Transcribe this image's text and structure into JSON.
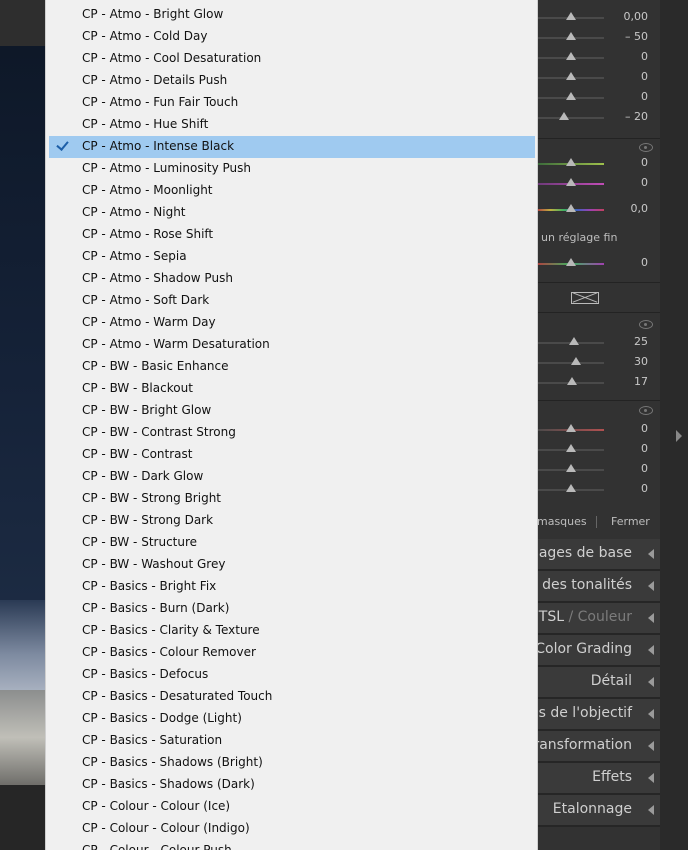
{
  "menu": {
    "items": [
      {
        "label": "CP - Atmo - Bright Glow"
      },
      {
        "label": "CP - Atmo - Cold Day"
      },
      {
        "label": "CP - Atmo - Cool Desaturation"
      },
      {
        "label": "CP - Atmo - Details Push"
      },
      {
        "label": "CP - Atmo - Fun Fair Touch"
      },
      {
        "label": "CP - Atmo - Hue Shift"
      },
      {
        "label": "CP - Atmo - Intense Black",
        "selected": true
      },
      {
        "label": "CP - Atmo - Luminosity Push"
      },
      {
        "label": "CP - Atmo - Moonlight"
      },
      {
        "label": "CP - Atmo - Night"
      },
      {
        "label": "CP - Atmo - Rose Shift"
      },
      {
        "label": "CP - Atmo - Sepia"
      },
      {
        "label": "CP - Atmo - Shadow Push"
      },
      {
        "label": "CP - Atmo - Soft Dark"
      },
      {
        "label": "CP - Atmo - Warm Day"
      },
      {
        "label": "CP - Atmo - Warm Desaturation"
      },
      {
        "label": "CP - BW - Basic Enhance"
      },
      {
        "label": "CP - BW - Blackout"
      },
      {
        "label": "CP - BW - Bright Glow"
      },
      {
        "label": "CP - BW - Contrast Strong"
      },
      {
        "label": "CP - BW - Contrast"
      },
      {
        "label": "CP - BW - Dark Glow"
      },
      {
        "label": "CP - BW - Strong Bright"
      },
      {
        "label": "CP - BW - Strong Dark"
      },
      {
        "label": "CP - BW - Structure"
      },
      {
        "label": "CP - BW - Washout Grey"
      },
      {
        "label": "CP - Basics - Bright Fix"
      },
      {
        "label": "CP - Basics - Burn (Dark)"
      },
      {
        "label": "CP - Basics - Clarity & Texture"
      },
      {
        "label": "CP - Basics - Colour Remover"
      },
      {
        "label": "CP - Basics - Defocus"
      },
      {
        "label": "CP - Basics - Desaturated Touch"
      },
      {
        "label": "CP - Basics - Dodge (Light)"
      },
      {
        "label": "CP - Basics - Saturation"
      },
      {
        "label": "CP - Basics - Shadows (Bright)"
      },
      {
        "label": "CP - Basics - Shadows (Dark)"
      },
      {
        "label": "CP - Colour - Colour (Ice)"
      },
      {
        "label": "CP - Colour - Colour (Indigo)"
      },
      {
        "label": "CP - Colour - Colour Push"
      }
    ],
    "selected_color": "#9fcaf0"
  },
  "panel": {
    "sliders_top": [
      {
        "value": "0,00",
        "level": 0.5
      },
      {
        "value": "– 50",
        "level": 0.5
      },
      {
        "value": "0",
        "level": 0.5
      },
      {
        "value": "0",
        "level": 0.5
      },
      {
        "value": "0",
        "level": 0.5
      },
      {
        "value": "– 20",
        "level": 0.4
      }
    ],
    "sliders_color": [
      {
        "value": "0",
        "level": 0.5
      },
      {
        "value": "0",
        "level": 0.5
      },
      {
        "value": "0,0",
        "level": 0.5
      }
    ],
    "fine_adjust_text": "un réglage fin",
    "slider_fine": {
      "value": "0",
      "level": 0.5
    },
    "sliders_mid": [
      {
        "value": "25",
        "level": 0.55
      },
      {
        "value": "30",
        "level": 0.58
      },
      {
        "value": "17",
        "level": 0.52
      }
    ],
    "sliders_bottom": [
      {
        "value": "0",
        "level": 0.5
      },
      {
        "value": "0",
        "level": 0.5
      },
      {
        "value": "0",
        "level": 0.5
      },
      {
        "value": "0",
        "level": 0.5
      }
    ],
    "masks_label": "masques",
    "close_label": "Fermer",
    "sections": [
      {
        "label": "glages de base"
      },
      {
        "label": "e des tonalités"
      },
      {
        "label_main": "TSL",
        "label_sep": " / ",
        "label_dim": "Couleur"
      },
      {
        "label": "Color Grading"
      },
      {
        "label": "Détail"
      },
      {
        "label": "ns de l'objectif"
      },
      {
        "label": "Transformation"
      },
      {
        "label": "Effets"
      },
      {
        "label": "Etalonnage"
      }
    ],
    "icons": [
      "eye-icon",
      "panel-collapse-icon",
      "crossed-box-icon",
      "checkmark-icon"
    ]
  }
}
